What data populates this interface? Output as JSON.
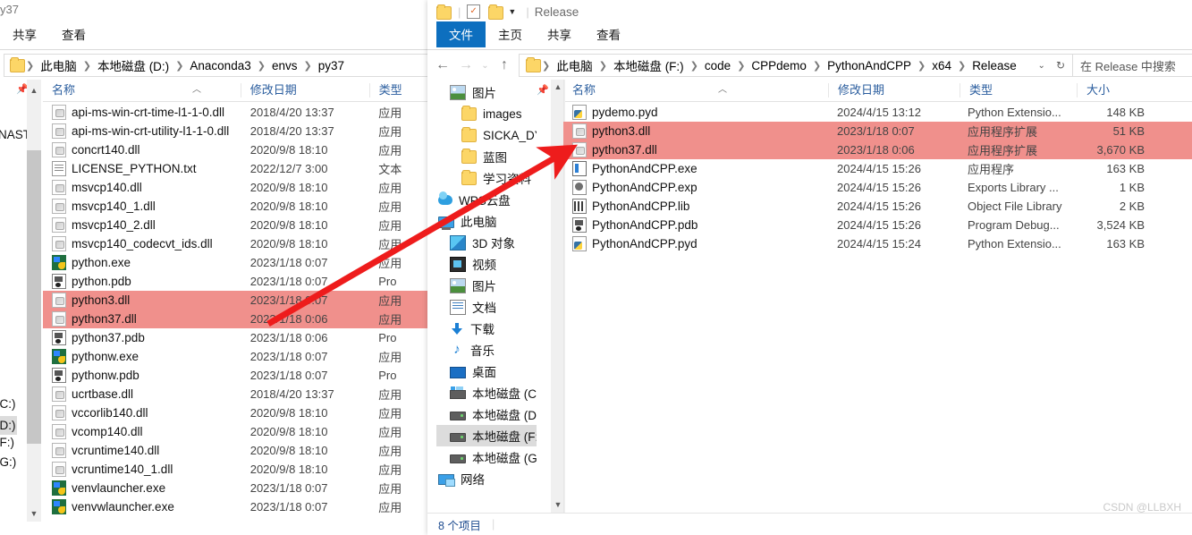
{
  "left_window": {
    "titlebar_fragment": "y37",
    "ribbon_tabs": [
      {
        "label": "共享",
        "active": false
      },
      {
        "label": "查看",
        "active": false
      }
    ],
    "breadcrumb": [
      "此电脑",
      "本地磁盘 (D:)",
      "Anaconda3",
      "envs",
      "py37"
    ],
    "columns": [
      "名称",
      "修改日期",
      "类型"
    ],
    "nav_fragments": [
      "NAST",
      "(C:)",
      "(D:)",
      "(F:)",
      "(G:)"
    ],
    "files": [
      {
        "name": "api-ms-win-crt-time-l1-1-0.dll",
        "icon": "dll",
        "date": "2018/4/20 13:37",
        "type": "应用",
        "selected": false
      },
      {
        "name": "api-ms-win-crt-utility-l1-1-0.dll",
        "icon": "dll",
        "date": "2018/4/20 13:37",
        "type": "应用",
        "selected": false
      },
      {
        "name": "concrt140.dll",
        "icon": "dll",
        "date": "2020/9/8 18:10",
        "type": "应用",
        "selected": false
      },
      {
        "name": "LICENSE_PYTHON.txt",
        "icon": "txt",
        "date": "2022/12/7 3:00",
        "type": "文本",
        "selected": false
      },
      {
        "name": "msvcp140.dll",
        "icon": "dll",
        "date": "2020/9/8 18:10",
        "type": "应用",
        "selected": false
      },
      {
        "name": "msvcp140_1.dll",
        "icon": "dll",
        "date": "2020/9/8 18:10",
        "type": "应用",
        "selected": false
      },
      {
        "name": "msvcp140_2.dll",
        "icon": "dll",
        "date": "2020/9/8 18:10",
        "type": "应用",
        "selected": false
      },
      {
        "name": "msvcp140_codecvt_ids.dll",
        "icon": "dll",
        "date": "2020/9/8 18:10",
        "type": "应用",
        "selected": false
      },
      {
        "name": "python.exe",
        "icon": "exe",
        "date": "2023/1/18 0:07",
        "type": "应用",
        "selected": false
      },
      {
        "name": "python.pdb",
        "icon": "pdb",
        "date": "2023/1/18 0:07",
        "type": "Pro",
        "selected": false
      },
      {
        "name": "python3.dll",
        "icon": "dll",
        "date": "2023/1/18 0:07",
        "type": "应用",
        "selected": true
      },
      {
        "name": "python37.dll",
        "icon": "dll",
        "date": "2023/1/18 0:06",
        "type": "应用",
        "selected": true
      },
      {
        "name": "python37.pdb",
        "icon": "pdb",
        "date": "2023/1/18 0:06",
        "type": "Pro",
        "selected": false
      },
      {
        "name": "pythonw.exe",
        "icon": "exe",
        "date": "2023/1/18 0:07",
        "type": "应用",
        "selected": false
      },
      {
        "name": "pythonw.pdb",
        "icon": "pdb",
        "date": "2023/1/18 0:07",
        "type": "Pro",
        "selected": false
      },
      {
        "name": "ucrtbase.dll",
        "icon": "dll",
        "date": "2018/4/20 13:37",
        "type": "应用",
        "selected": false
      },
      {
        "name": "vccorlib140.dll",
        "icon": "dll",
        "date": "2020/9/8 18:10",
        "type": "应用",
        "selected": false
      },
      {
        "name": "vcomp140.dll",
        "icon": "dll",
        "date": "2020/9/8 18:10",
        "type": "应用",
        "selected": false
      },
      {
        "name": "vcruntime140.dll",
        "icon": "dll",
        "date": "2020/9/8 18:10",
        "type": "应用",
        "selected": false
      },
      {
        "name": "vcruntime140_1.dll",
        "icon": "dll",
        "date": "2020/9/8 18:10",
        "type": "应用",
        "selected": false
      },
      {
        "name": "venvlauncher.exe",
        "icon": "exe",
        "date": "2023/1/18 0:07",
        "type": "应用",
        "selected": false
      },
      {
        "name": "venvwlauncher.exe",
        "icon": "exe",
        "date": "2023/1/18 0:07",
        "type": "应用",
        "selected": false
      }
    ]
  },
  "right_window": {
    "quick_access_title": "Release",
    "ribbon_tabs": [
      {
        "label": "文件",
        "active": true
      },
      {
        "label": "主页",
        "active": false
      },
      {
        "label": "共享",
        "active": false
      },
      {
        "label": "查看",
        "active": false
      }
    ],
    "breadcrumb": [
      "此电脑",
      "本地磁盘 (F:)",
      "code",
      "CPPdemo",
      "PythonAndCPP",
      "x64",
      "Release"
    ],
    "search_placeholder": "在 Release 中搜索",
    "columns": [
      "名称",
      "修改日期",
      "类型",
      "大小"
    ],
    "nav_items": [
      {
        "label": "图片",
        "icon": "pic",
        "indent": 1,
        "pinned": true,
        "selected": false
      },
      {
        "label": "images",
        "icon": "folder",
        "indent": 2,
        "pinned": false,
        "selected": false
      },
      {
        "label": "SICKA_DYNAST",
        "icon": "folder",
        "indent": 2,
        "pinned": false,
        "selected": false
      },
      {
        "label": "蓝图",
        "icon": "folder",
        "indent": 2,
        "pinned": false,
        "selected": false
      },
      {
        "label": "学习资料",
        "icon": "folder",
        "indent": 2,
        "pinned": false,
        "selected": false
      },
      {
        "label": "WPS云盘",
        "icon": "cloud",
        "indent": 0,
        "pinned": false,
        "selected": false
      },
      {
        "label": "此电脑",
        "icon": "pc",
        "indent": 0,
        "pinned": false,
        "selected": false
      },
      {
        "label": "3D 对象",
        "icon": "cube",
        "indent": 1,
        "pinned": false,
        "selected": false
      },
      {
        "label": "视频",
        "icon": "vid",
        "indent": 1,
        "pinned": false,
        "selected": false
      },
      {
        "label": "图片",
        "icon": "pic",
        "indent": 1,
        "pinned": false,
        "selected": false
      },
      {
        "label": "文档",
        "icon": "doc",
        "indent": 1,
        "pinned": false,
        "selected": false
      },
      {
        "label": "下载",
        "icon": "dl",
        "indent": 1,
        "pinned": false,
        "selected": false
      },
      {
        "label": "音乐",
        "icon": "mus",
        "indent": 1,
        "pinned": false,
        "selected": false
      },
      {
        "label": "桌面",
        "icon": "desk",
        "indent": 1,
        "pinned": false,
        "selected": false
      },
      {
        "label": "本地磁盘 (C:)",
        "icon": "drivec",
        "indent": 1,
        "pinned": false,
        "selected": false
      },
      {
        "label": "本地磁盘 (D:)",
        "icon": "drive",
        "indent": 1,
        "pinned": false,
        "selected": false
      },
      {
        "label": "本地磁盘 (F:)",
        "icon": "drive",
        "indent": 1,
        "pinned": false,
        "selected": true
      },
      {
        "label": "本地磁盘 (G:)",
        "icon": "drive",
        "indent": 1,
        "pinned": false,
        "selected": false
      },
      {
        "label": "网络",
        "icon": "net",
        "indent": 0,
        "pinned": false,
        "selected": false
      }
    ],
    "files": [
      {
        "name": "pydemo.pyd",
        "icon": "pyd",
        "date": "2024/4/15 13:12",
        "type": "Python Extensio...",
        "size": "148 KB",
        "selected": false
      },
      {
        "name": "python3.dll",
        "icon": "dll",
        "date": "2023/1/18 0:07",
        "type": "应用程序扩展",
        "size": "51 KB",
        "selected": true
      },
      {
        "name": "python37.dll",
        "icon": "dll",
        "date": "2023/1/18 0:06",
        "type": "应用程序扩展",
        "size": "3,670 KB",
        "selected": true
      },
      {
        "name": "PythonAndCPP.exe",
        "icon": "appexe",
        "date": "2024/4/15 15:26",
        "type": "应用程序",
        "size": "163 KB",
        "selected": false
      },
      {
        "name": "PythonAndCPP.exp",
        "icon": "exp",
        "date": "2024/4/15 15:26",
        "type": "Exports Library ...",
        "size": "1 KB",
        "selected": false
      },
      {
        "name": "PythonAndCPP.lib",
        "icon": "lib",
        "date": "2024/4/15 15:26",
        "type": "Object File Library",
        "size": "2 KB",
        "selected": false
      },
      {
        "name": "PythonAndCPP.pdb",
        "icon": "pdb",
        "date": "2024/4/15 15:26",
        "type": "Program Debug...",
        "size": "3,524 KB",
        "selected": false
      },
      {
        "name": "PythonAndCPP.pyd",
        "icon": "pyd",
        "date": "2024/4/15 15:24",
        "type": "Python Extensio...",
        "size": "163 KB",
        "selected": false
      }
    ],
    "status": "8 个项目"
  },
  "annotation": {
    "arrow_color": "#ee1c1c",
    "highlight_color": "#f0908c"
  },
  "watermark": "CSDN @LLBXH"
}
